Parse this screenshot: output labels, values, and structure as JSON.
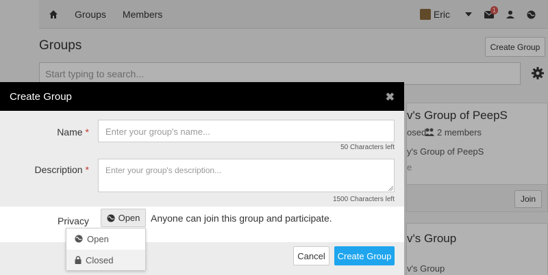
{
  "navbar": {
    "links": [
      "Groups",
      "Members"
    ],
    "user_name": "Eric",
    "notification_count": "1"
  },
  "page": {
    "title": "Groups",
    "create_button": "Create Group",
    "search_placeholder": "Start typing to search..."
  },
  "background_cards": [
    {
      "title": "v's Group of PeepS",
      "status": "osed",
      "members": "2 members",
      "desc": "y's Group of PeepS",
      "extra": "e",
      "join_label": "Join"
    },
    {
      "title": "v's Group",
      "desc": "v's Group"
    }
  ],
  "modal": {
    "title": "Create Group",
    "close_glyph": "✖",
    "name_label": "Name",
    "name_placeholder": "Enter your group's name...",
    "name_count": "50 Characters left",
    "description_label": "Description",
    "description_placeholder": "Enter your group's description...",
    "description_count": "1500 Characters left",
    "required_marker": "*",
    "privacy_label": "Privacy",
    "privacy_selected": "Open",
    "privacy_description": "Anyone can join this group and participate.",
    "privacy_options": [
      "Open",
      "Closed"
    ],
    "cancel_label": "Cancel",
    "submit_label": "Create Group"
  },
  "colors": {
    "primary": "#1ea5ee",
    "required": "#c0392b",
    "header_bg": "#000000",
    "badge": "#d9534f"
  }
}
